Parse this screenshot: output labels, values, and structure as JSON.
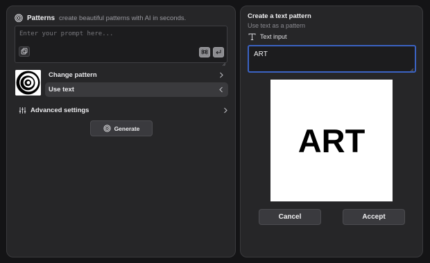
{
  "header": {
    "app_name": "Patterns",
    "tagline": "create beautiful patterns with AI in seconds."
  },
  "prompt": {
    "placeholder": "Enter your prompt here..."
  },
  "options": {
    "change_pattern": "Change pattern",
    "use_text": "Use text",
    "advanced_settings": "Advanced settings"
  },
  "actions": {
    "generate": "Generate"
  },
  "text_pattern": {
    "title": "Create a text pattern",
    "subtitle": "Use text as a pattern",
    "input_label": "Text input",
    "input_value": "ART",
    "preview_text": "ART",
    "cancel": "Cancel",
    "accept": "Accept"
  },
  "colors": {
    "background": "#141416",
    "panel": "#262628",
    "focus_border": "#3b63c4",
    "active_row": "#3a3a3d"
  },
  "icons": {
    "logo": "spiral-icon",
    "image_upload": "image-icon",
    "command_key": "command-icon",
    "enter_key": "return-icon",
    "advanced": "sliders-icon",
    "text_input": "text-type-icon",
    "generate": "spiral-icon"
  }
}
